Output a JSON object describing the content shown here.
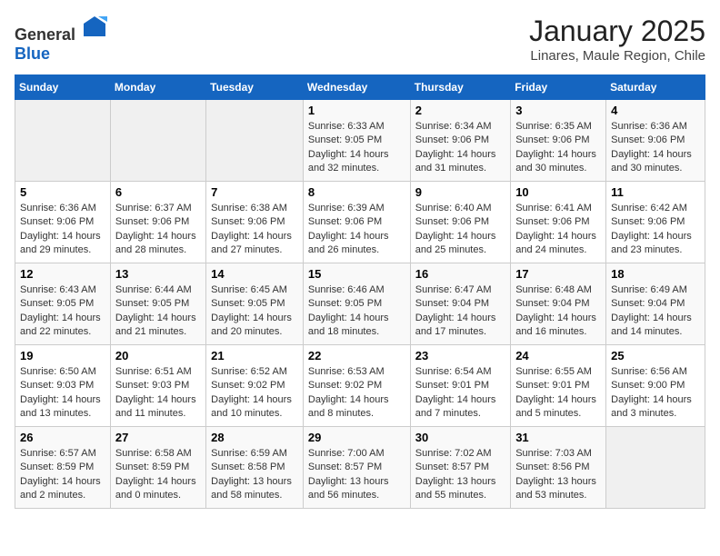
{
  "header": {
    "logo": {
      "general": "General",
      "blue": "Blue"
    },
    "title": "January 2025",
    "subtitle": "Linares, Maule Region, Chile"
  },
  "weekdays": [
    "Sunday",
    "Monday",
    "Tuesday",
    "Wednesday",
    "Thursday",
    "Friday",
    "Saturday"
  ],
  "weeks": [
    [
      {
        "day": "",
        "sunrise": "",
        "sunset": "",
        "daylight": "",
        "empty": true
      },
      {
        "day": "",
        "sunrise": "",
        "sunset": "",
        "daylight": "",
        "empty": true
      },
      {
        "day": "",
        "sunrise": "",
        "sunset": "",
        "daylight": "",
        "empty": true
      },
      {
        "day": "1",
        "sunrise": "Sunrise: 6:33 AM",
        "sunset": "Sunset: 9:05 PM",
        "daylight": "Daylight: 14 hours and 32 minutes."
      },
      {
        "day": "2",
        "sunrise": "Sunrise: 6:34 AM",
        "sunset": "Sunset: 9:06 PM",
        "daylight": "Daylight: 14 hours and 31 minutes."
      },
      {
        "day": "3",
        "sunrise": "Sunrise: 6:35 AM",
        "sunset": "Sunset: 9:06 PM",
        "daylight": "Daylight: 14 hours and 30 minutes."
      },
      {
        "day": "4",
        "sunrise": "Sunrise: 6:36 AM",
        "sunset": "Sunset: 9:06 PM",
        "daylight": "Daylight: 14 hours and 30 minutes."
      }
    ],
    [
      {
        "day": "5",
        "sunrise": "Sunrise: 6:36 AM",
        "sunset": "Sunset: 9:06 PM",
        "daylight": "Daylight: 14 hours and 29 minutes."
      },
      {
        "day": "6",
        "sunrise": "Sunrise: 6:37 AM",
        "sunset": "Sunset: 9:06 PM",
        "daylight": "Daylight: 14 hours and 28 minutes."
      },
      {
        "day": "7",
        "sunrise": "Sunrise: 6:38 AM",
        "sunset": "Sunset: 9:06 PM",
        "daylight": "Daylight: 14 hours and 27 minutes."
      },
      {
        "day": "8",
        "sunrise": "Sunrise: 6:39 AM",
        "sunset": "Sunset: 9:06 PM",
        "daylight": "Daylight: 14 hours and 26 minutes."
      },
      {
        "day": "9",
        "sunrise": "Sunrise: 6:40 AM",
        "sunset": "Sunset: 9:06 PM",
        "daylight": "Daylight: 14 hours and 25 minutes."
      },
      {
        "day": "10",
        "sunrise": "Sunrise: 6:41 AM",
        "sunset": "Sunset: 9:06 PM",
        "daylight": "Daylight: 14 hours and 24 minutes."
      },
      {
        "day": "11",
        "sunrise": "Sunrise: 6:42 AM",
        "sunset": "Sunset: 9:06 PM",
        "daylight": "Daylight: 14 hours and 23 minutes."
      }
    ],
    [
      {
        "day": "12",
        "sunrise": "Sunrise: 6:43 AM",
        "sunset": "Sunset: 9:05 PM",
        "daylight": "Daylight: 14 hours and 22 minutes."
      },
      {
        "day": "13",
        "sunrise": "Sunrise: 6:44 AM",
        "sunset": "Sunset: 9:05 PM",
        "daylight": "Daylight: 14 hours and 21 minutes."
      },
      {
        "day": "14",
        "sunrise": "Sunrise: 6:45 AM",
        "sunset": "Sunset: 9:05 PM",
        "daylight": "Daylight: 14 hours and 20 minutes."
      },
      {
        "day": "15",
        "sunrise": "Sunrise: 6:46 AM",
        "sunset": "Sunset: 9:05 PM",
        "daylight": "Daylight: 14 hours and 18 minutes."
      },
      {
        "day": "16",
        "sunrise": "Sunrise: 6:47 AM",
        "sunset": "Sunset: 9:04 PM",
        "daylight": "Daylight: 14 hours and 17 minutes."
      },
      {
        "day": "17",
        "sunrise": "Sunrise: 6:48 AM",
        "sunset": "Sunset: 9:04 PM",
        "daylight": "Daylight: 14 hours and 16 minutes."
      },
      {
        "day": "18",
        "sunrise": "Sunrise: 6:49 AM",
        "sunset": "Sunset: 9:04 PM",
        "daylight": "Daylight: 14 hours and 14 minutes."
      }
    ],
    [
      {
        "day": "19",
        "sunrise": "Sunrise: 6:50 AM",
        "sunset": "Sunset: 9:03 PM",
        "daylight": "Daylight: 14 hours and 13 minutes."
      },
      {
        "day": "20",
        "sunrise": "Sunrise: 6:51 AM",
        "sunset": "Sunset: 9:03 PM",
        "daylight": "Daylight: 14 hours and 11 minutes."
      },
      {
        "day": "21",
        "sunrise": "Sunrise: 6:52 AM",
        "sunset": "Sunset: 9:02 PM",
        "daylight": "Daylight: 14 hours and 10 minutes."
      },
      {
        "day": "22",
        "sunrise": "Sunrise: 6:53 AM",
        "sunset": "Sunset: 9:02 PM",
        "daylight": "Daylight: 14 hours and 8 minutes."
      },
      {
        "day": "23",
        "sunrise": "Sunrise: 6:54 AM",
        "sunset": "Sunset: 9:01 PM",
        "daylight": "Daylight: 14 hours and 7 minutes."
      },
      {
        "day": "24",
        "sunrise": "Sunrise: 6:55 AM",
        "sunset": "Sunset: 9:01 PM",
        "daylight": "Daylight: 14 hours and 5 minutes."
      },
      {
        "day": "25",
        "sunrise": "Sunrise: 6:56 AM",
        "sunset": "Sunset: 9:00 PM",
        "daylight": "Daylight: 14 hours and 3 minutes."
      }
    ],
    [
      {
        "day": "26",
        "sunrise": "Sunrise: 6:57 AM",
        "sunset": "Sunset: 8:59 PM",
        "daylight": "Daylight: 14 hours and 2 minutes."
      },
      {
        "day": "27",
        "sunrise": "Sunrise: 6:58 AM",
        "sunset": "Sunset: 8:59 PM",
        "daylight": "Daylight: 14 hours and 0 minutes."
      },
      {
        "day": "28",
        "sunrise": "Sunrise: 6:59 AM",
        "sunset": "Sunset: 8:58 PM",
        "daylight": "Daylight: 13 hours and 58 minutes."
      },
      {
        "day": "29",
        "sunrise": "Sunrise: 7:00 AM",
        "sunset": "Sunset: 8:57 PM",
        "daylight": "Daylight: 13 hours and 56 minutes."
      },
      {
        "day": "30",
        "sunrise": "Sunrise: 7:02 AM",
        "sunset": "Sunset: 8:57 PM",
        "daylight": "Daylight: 13 hours and 55 minutes."
      },
      {
        "day": "31",
        "sunrise": "Sunrise: 7:03 AM",
        "sunset": "Sunset: 8:56 PM",
        "daylight": "Daylight: 13 hours and 53 minutes."
      },
      {
        "day": "",
        "sunrise": "",
        "sunset": "",
        "daylight": "",
        "empty": true
      }
    ]
  ]
}
